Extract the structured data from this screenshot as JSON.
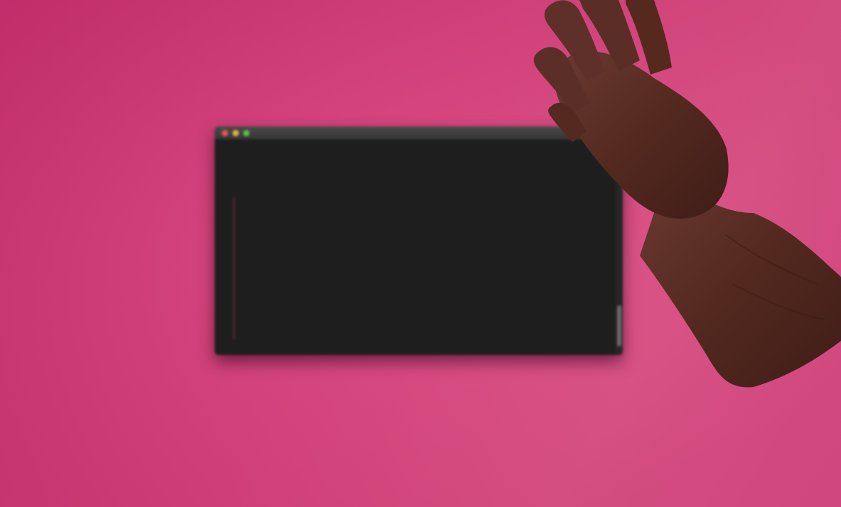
{
  "desktop": {
    "background_color": "#d9447f"
  },
  "terminal": {
    "window_title": "",
    "lines": [
      "",
      "",
      ""
    ],
    "scroll_position": 0.95
  },
  "hand": {
    "icon": "hand-icon",
    "skin_color": "#5a2f2a"
  }
}
